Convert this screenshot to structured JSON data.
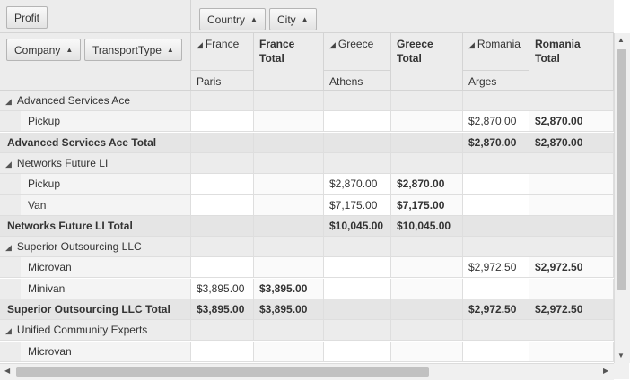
{
  "filter_area": {
    "chips": [
      {
        "label": "Profit"
      }
    ]
  },
  "column_area": {
    "chips": [
      {
        "label": "Country"
      },
      {
        "label": "City"
      }
    ]
  },
  "row_area": {
    "chips": [
      {
        "label": "Company"
      },
      {
        "label": "TransportType"
      }
    ]
  },
  "sort_icon": "sort-ascending-icon",
  "columns": [
    {
      "key": "france",
      "label": "France",
      "sub_label": "Paris",
      "expandable": true,
      "is_total": false
    },
    {
      "key": "france_total",
      "label": "France Total",
      "sub_label": "",
      "expandable": false,
      "is_total": true
    },
    {
      "key": "greece",
      "label": "Greece",
      "sub_label": "Athens",
      "expandable": true,
      "is_total": false
    },
    {
      "key": "greece_total",
      "label": "Greece Total",
      "sub_label": "",
      "expandable": false,
      "is_total": true
    },
    {
      "key": "romania",
      "label": "Romania",
      "sub_label": "Arges",
      "expandable": true,
      "is_total": false
    },
    {
      "key": "romania_total",
      "label": "Romania Total",
      "sub_label": "",
      "expandable": false,
      "is_total": true
    }
  ],
  "rows": [
    {
      "type": "group",
      "label": "Advanced Services Ace",
      "values": [
        "",
        "",
        "",
        "",
        "",
        ""
      ]
    },
    {
      "type": "item",
      "label": "Pickup",
      "values": [
        "",
        "",
        "",
        "",
        "$2,870.00",
        "$2,870.00"
      ]
    },
    {
      "type": "total",
      "label": "Advanced Services Ace Total",
      "values": [
        "",
        "",
        "",
        "",
        "$2,870.00",
        "$2,870.00"
      ]
    },
    {
      "type": "group",
      "label": "Networks Future LI",
      "values": [
        "",
        "",
        "",
        "",
        "",
        ""
      ]
    },
    {
      "type": "item",
      "label": "Pickup",
      "values": [
        "",
        "",
        "$2,870.00",
        "$2,870.00",
        "",
        ""
      ]
    },
    {
      "type": "item",
      "label": "Van",
      "values": [
        "",
        "",
        "$7,175.00",
        "$7,175.00",
        "",
        ""
      ]
    },
    {
      "type": "total",
      "label": "Networks Future LI Total",
      "values": [
        "",
        "",
        "$10,045.00",
        "$10,045.00",
        "",
        ""
      ]
    },
    {
      "type": "group",
      "label": "Superior Outsourcing LLC",
      "values": [
        "",
        "",
        "",
        "",
        "",
        ""
      ]
    },
    {
      "type": "item",
      "label": "Microvan",
      "values": [
        "",
        "",
        "",
        "",
        "$2,972.50",
        "$2,972.50"
      ]
    },
    {
      "type": "item",
      "label": "Minivan",
      "values": [
        "$3,895.00",
        "$3,895.00",
        "",
        "",
        "",
        ""
      ]
    },
    {
      "type": "total",
      "label": "Superior Outsourcing LLC Total",
      "values": [
        "$3,895.00",
        "$3,895.00",
        "",
        "",
        "$2,972.50",
        "$2,972.50"
      ]
    },
    {
      "type": "group",
      "label": "Unified Community Experts",
      "values": [
        "",
        "",
        "",
        "",
        "",
        ""
      ]
    },
    {
      "type": "item",
      "label": "Microvan",
      "values": [
        "",
        "",
        "",
        "",
        "",
        ""
      ]
    }
  ]
}
